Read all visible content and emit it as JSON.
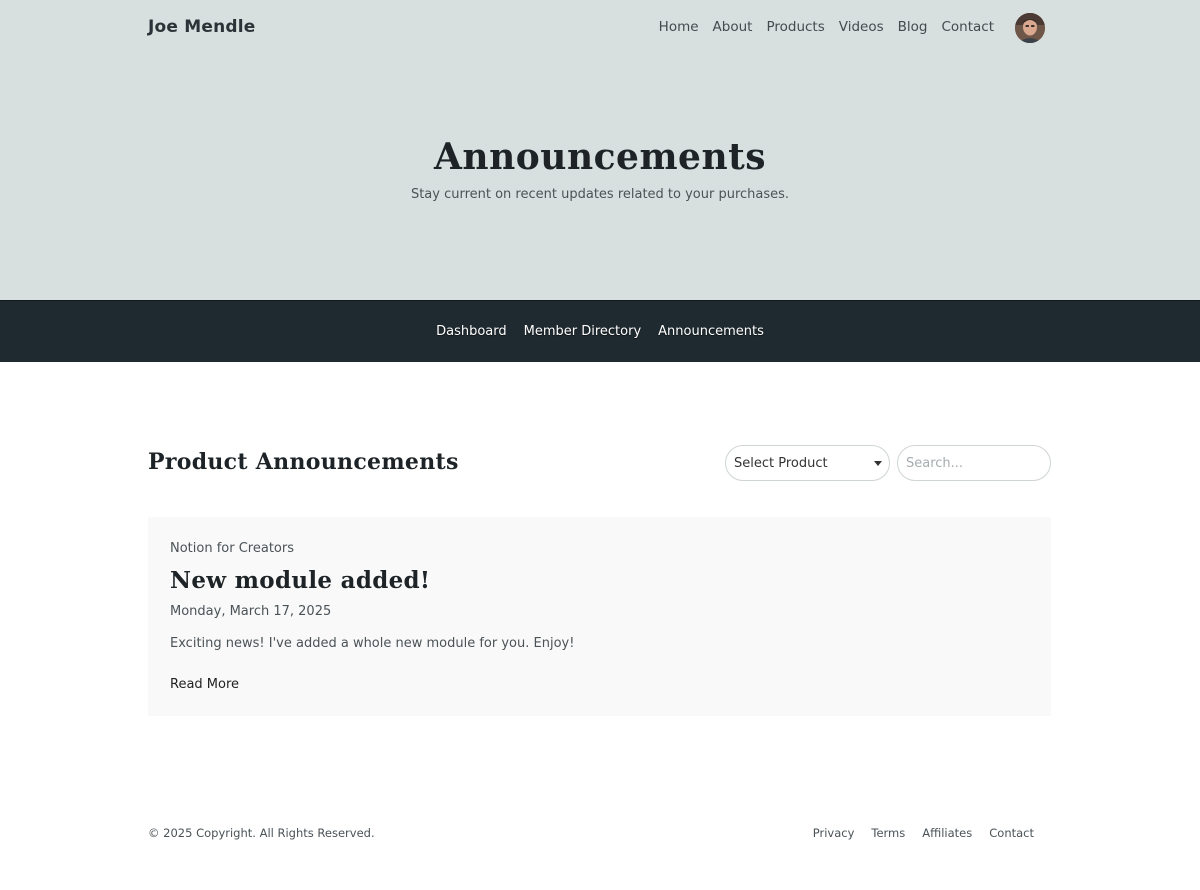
{
  "header": {
    "brand": "Joe Mendle",
    "nav": [
      "Home",
      "About",
      "Products",
      "Videos",
      "Blog",
      "Contact"
    ],
    "avatar_icon": "user-avatar"
  },
  "hero": {
    "title": "Announcements",
    "subtitle": "Stay current on recent updates related to your purchases."
  },
  "subnav": {
    "items": [
      "Dashboard",
      "Member Directory",
      "Announcements"
    ]
  },
  "main": {
    "title": "Product Announcements",
    "product_select": "Select Product",
    "search_placeholder": "Search..."
  },
  "announcements": [
    {
      "product": "Notion for Creators",
      "title": "New module added!",
      "date": "Monday, March 17, 2025",
      "body": "Exciting news! I've added a whole new module for you. Enjoy!",
      "link": "Read More"
    }
  ],
  "footer": {
    "copyright": "© 2025 Copyright. All Rights Reserved.",
    "links": [
      "Privacy",
      "Terms",
      "Affiliates",
      "Contact"
    ]
  },
  "colors": {
    "hero_bg": "#d8dfdf",
    "subnav_bg": "#1f2a30",
    "card_bg": "#f9f9f9"
  }
}
